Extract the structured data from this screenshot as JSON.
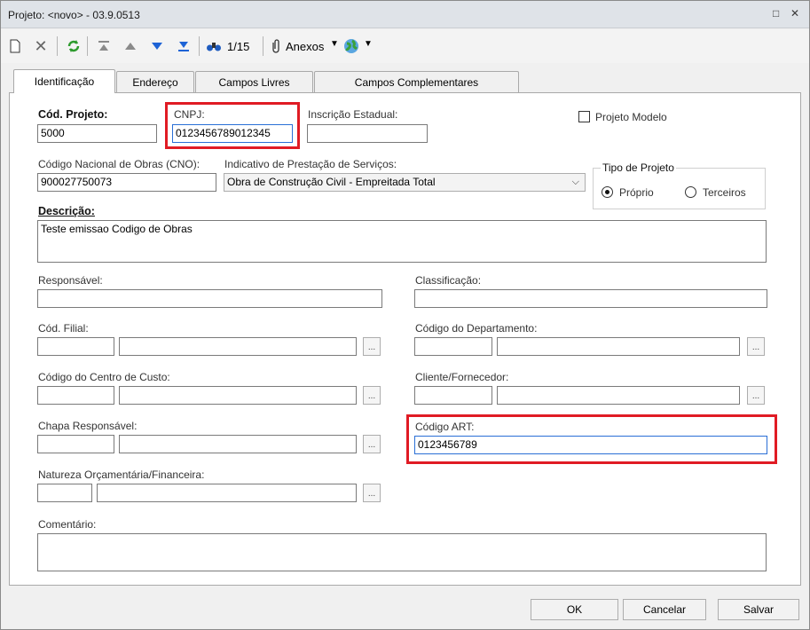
{
  "window": {
    "title": "Projeto: <novo> - 03.9.0513",
    "restore_glyph": "□",
    "close_glyph": "✕"
  },
  "toolbar": {
    "record_counter": "1/15",
    "attachments_label": "Anexos"
  },
  "tabs": [
    {
      "label": "Identificação"
    },
    {
      "label": "Endereço"
    },
    {
      "label": "Campos Livres"
    },
    {
      "label": "Campos Complementares"
    }
  ],
  "form": {
    "cod_projeto": {
      "label": "Cód. Projeto:",
      "value": "5000"
    },
    "cnpj": {
      "label": "CNPJ:",
      "value": "0123456789012345"
    },
    "inscricao_estadual": {
      "label": "Inscrição Estadual:",
      "value": ""
    },
    "projeto_modelo": {
      "label": "Projeto Modelo",
      "checked": false
    },
    "cno": {
      "label": "Código Nacional de Obras (CNO):",
      "value": "900027750073"
    },
    "indicativo": {
      "label": "Indicativo de Prestação de Serviços:",
      "value": "Obra de Construção Civil - Empreitada Total"
    },
    "tipo_projeto": {
      "label": "Tipo de Projeto",
      "options": [
        "Próprio",
        "Terceiros"
      ],
      "selected": "Próprio"
    },
    "descricao": {
      "label": "Descrição:",
      "value": "Teste emissao Codigo de Obras"
    },
    "responsavel": {
      "label": "Responsável:",
      "value": ""
    },
    "classificacao": {
      "label": "Classificação:",
      "value": ""
    },
    "cod_filial": {
      "label": "Cód. Filial:"
    },
    "cod_departamento": {
      "label": "Código do Departamento:"
    },
    "centro_custo": {
      "label": "Código do Centro de Custo:"
    },
    "cliente_fornecedor": {
      "label": "Cliente/Fornecedor:"
    },
    "chapa_responsavel": {
      "label": "Chapa Responsável:"
    },
    "codigo_art": {
      "label": "Código ART:",
      "value": "0123456789"
    },
    "natureza": {
      "label": "Natureza Orçamentária/Financeira:"
    },
    "comentario": {
      "label": "Comentário:",
      "value": ""
    },
    "lookup_button_label": "..."
  },
  "buttons": {
    "ok": "OK",
    "cancel": "Cancelar",
    "save": "Salvar"
  },
  "colors": {
    "highlight": "#e01b24",
    "accent": "#2a6fd6"
  }
}
